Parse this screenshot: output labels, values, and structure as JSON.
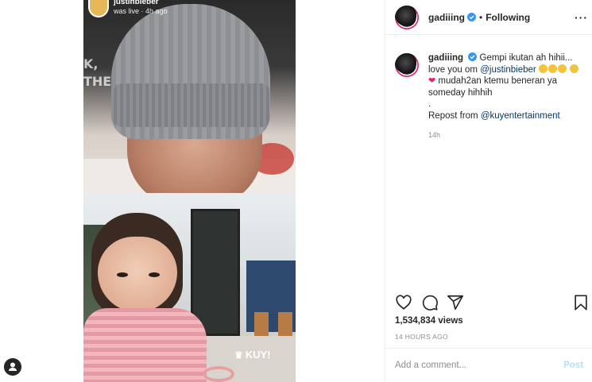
{
  "live": {
    "username": "justinbieber",
    "meta": "was live · 4h ago",
    "watermark": "KUY!"
  },
  "post": {
    "author": "gadiiing",
    "follow_status": "Following",
    "caption": {
      "author": "gadiiing",
      "line1": "Gempi ikutan ah hihii... love you om",
      "mention1": "@justinbieber",
      "line2": "mudah2an ktemu beneran ya someday hihhih",
      "line3": ".",
      "repost_label": "Repost from",
      "mention2": "@kuyentertainment",
      "age": "14h"
    },
    "views": "1,534,834 views",
    "posted": "14 HOURS AGO",
    "comment_placeholder": "Add a comment...",
    "post_label": "Post"
  },
  "colors": {
    "link": "#00376b",
    "verified": "#3897f0",
    "post_disabled": "#b2dffc"
  },
  "icons": [
    "more-icon",
    "verified-icon",
    "heart-icon",
    "comment-icon",
    "share-icon",
    "bookmark-icon",
    "user-icon"
  ]
}
